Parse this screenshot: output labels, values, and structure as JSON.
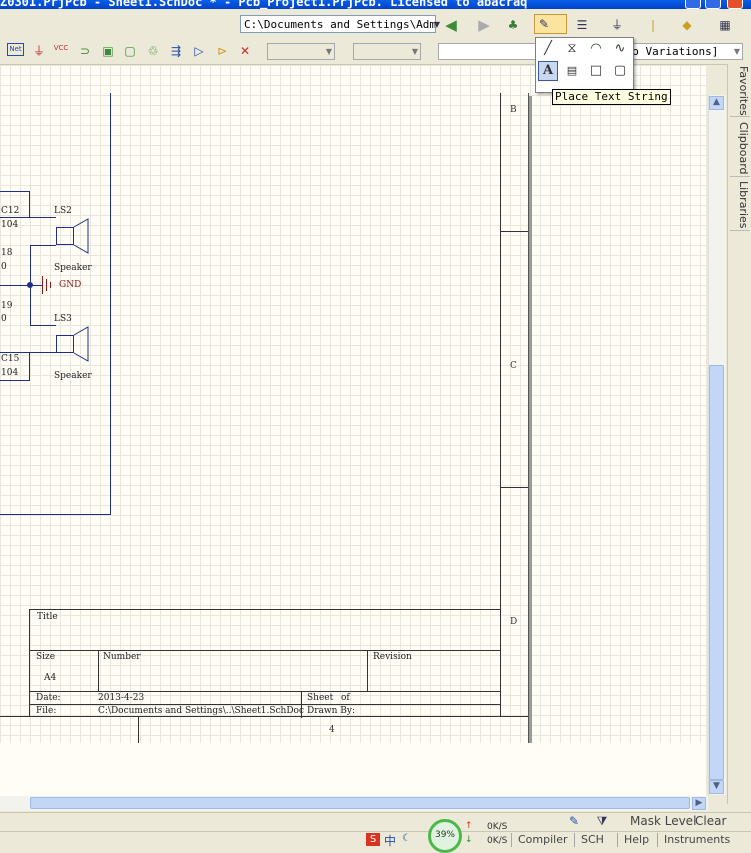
{
  "window": {
    "title": "Z0301.PrjPcb - Sheet1.SchDoc * - Pcb_Project1.PrjPcb. Licensed to abacraq"
  },
  "toolbar": {
    "path": "C:\\Documents and Settings\\Admir",
    "variations": "[No Variations]",
    "net_label": "Net",
    "vcc_label": "VCC"
  },
  "place_menu": {
    "tooltip": "Place Text String",
    "items": [
      "line-icon",
      "polygon-icon",
      "arc-icon",
      "bezier-icon",
      "text-string-icon",
      "text-frame-icon",
      "rectangle-icon",
      "round-rectangle-icon"
    ]
  },
  "schematic": {
    "components": {
      "c12": {
        "ref": "C12",
        "value": "104"
      },
      "ls2": {
        "ref": "LS2",
        "desc": "Speaker"
      },
      "r18": {
        "ref": "18",
        "value": "0"
      },
      "gnd": {
        "label": "GND"
      },
      "r19": {
        "ref": "19",
        "value": "0"
      },
      "ls3": {
        "ref": "LS3",
        "desc": "Speaker"
      },
      "c15": {
        "ref": "C15",
        "value": "104"
      }
    },
    "zones": {
      "b": "B",
      "c": "C",
      "d": "D",
      "col4": "4"
    },
    "title_block": {
      "title_label": "Title",
      "size_label": "Size",
      "size_value": "A4",
      "number_label": "Number",
      "revision_label": "Revision",
      "date_label": "Date:",
      "date_value": "2013-4-23",
      "sheet_label": "Sheet",
      "of_label": "of",
      "file_label": "File:",
      "file_value": "C:\\Documents and Settings\\..\\Sheet1.SchDoc",
      "drawn_label": "Drawn By:"
    }
  },
  "dock": {
    "tabs": [
      "Favorites",
      "Clipboard",
      "Libraries"
    ]
  },
  "statusbar": {
    "mask_level": "Mask Level",
    "clear": "Clear",
    "cpu_percent": "39%",
    "net_up": "0K/S",
    "net_down": "0K/S",
    "ime": "S",
    "ime_lang": "中",
    "panels": [
      "Compiler",
      "SCH",
      "Help",
      "Instruments"
    ]
  },
  "colors": {
    "accent": "#0a5ee8",
    "wire": "#1f2f8a",
    "gnd": "#8b1a1a"
  }
}
